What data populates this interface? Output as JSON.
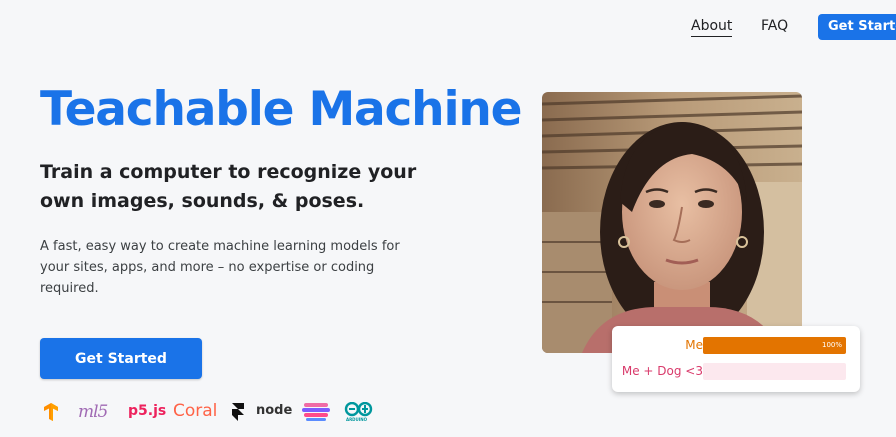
{
  "nav": {
    "about": "About",
    "faq": "FAQ",
    "cta": "Get Started"
  },
  "hero": {
    "title": "Teachable Machine",
    "subtitle": "Train a computer to recognize your own images, sounds, & poses.",
    "description": "A fast, easy way to create machine learning models for your sites, apps, and more – no expertise or coding required.",
    "cta": "Get Started"
  },
  "logos": [
    {
      "name": "tensorflow",
      "text": ""
    },
    {
      "name": "ml5",
      "text": "ml5"
    },
    {
      "name": "p5js",
      "text": "p5.js"
    },
    {
      "name": "coral",
      "text": "Coral"
    },
    {
      "name": "framer",
      "text": ""
    },
    {
      "name": "node",
      "text": "node"
    },
    {
      "name": "glitch",
      "text": ""
    },
    {
      "name": "arduino",
      "text": "ARDUINO"
    }
  ],
  "predictions": [
    {
      "label": "Me",
      "value": 1.0,
      "value_text": "100%",
      "color": "#e37400",
      "track": "#fde9d6"
    },
    {
      "label": "Me + Dog <3",
      "value": 0.0,
      "value_text": "",
      "color": "#d93a6b",
      "track": "#fce8ee"
    }
  ],
  "colors": {
    "accent": "#1a73e8",
    "background": "#f6f7f9"
  }
}
